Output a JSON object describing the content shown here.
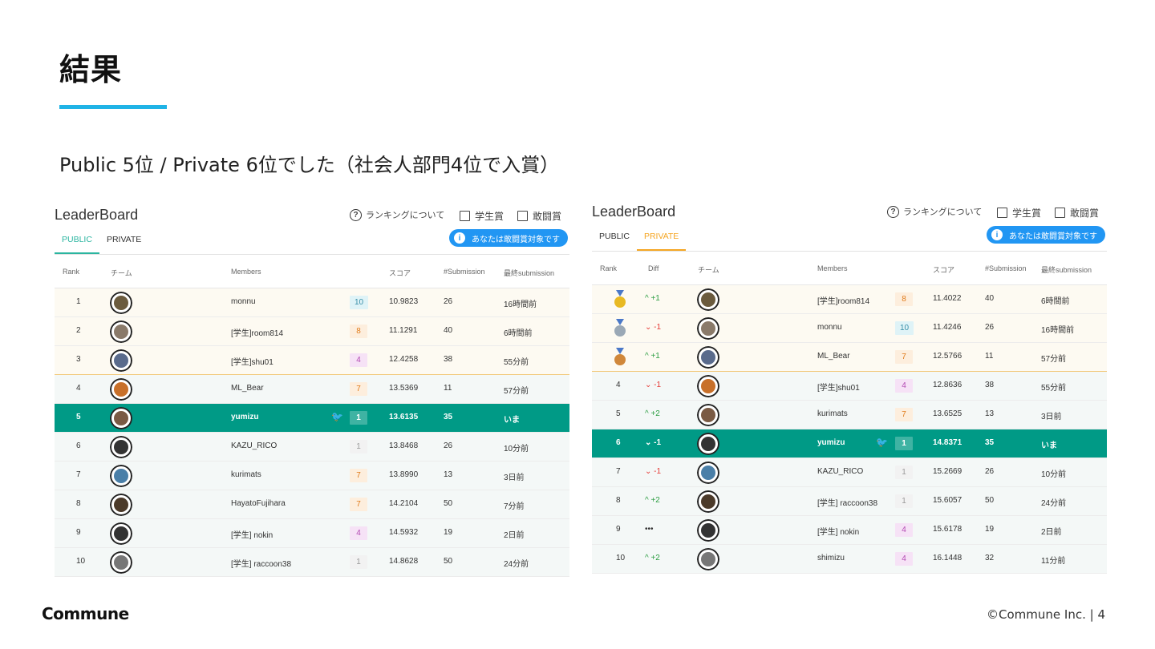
{
  "slide": {
    "title": "結果",
    "subtitle": "Public 5位 / Private 6位でした（社会人部門4位で入賞）",
    "brand": "Commune",
    "copyright": "©Commune Inc. | 4",
    "accent_color": "#1fb3e6"
  },
  "public_board": {
    "title": "LeaderBoard",
    "help_link": "ランキングについて",
    "checkbox_student": "学生賞",
    "checkbox_fighting": "敢闘賞",
    "fighting_badge": "あなたは敢闘賞対象です",
    "tab_public": "PUBLIC",
    "tab_private": "PRIVATE",
    "headers": {
      "rank": "Rank",
      "team": "チーム",
      "members": "Members",
      "score": "スコア",
      "submissions": "#Submission",
      "last": "最終submission"
    },
    "rows": [
      {
        "rank": "1",
        "members": "monnu",
        "count": "10",
        "score": "10.9823",
        "subs": "26",
        "last": "16時間前",
        "avatar": "anime-face-avatar"
      },
      {
        "rank": "2",
        "members": "[学生]room814",
        "count": "8",
        "score": "11.1291",
        "subs": "40",
        "last": "6時間前",
        "avatar": "group-avatar"
      },
      {
        "rank": "3",
        "members": "[学生]shu01",
        "count": "4",
        "score": "12.4258",
        "subs": "38",
        "last": "55分前",
        "avatar": "snowman-avatar"
      },
      {
        "rank": "4",
        "members": "ML_Bear",
        "count": "7",
        "score": "13.5369",
        "subs": "11",
        "last": "57分前",
        "avatar": "bear-avatar"
      },
      {
        "rank": "5",
        "members": "yumizu",
        "count": "1",
        "score": "13.6135",
        "subs": "35",
        "last": "いま",
        "avatar": "photo-avatar"
      },
      {
        "rank": "6",
        "members": "KAZU_RICO",
        "count": "1",
        "score": "13.8468",
        "subs": "26",
        "last": "10分前",
        "avatar": "default-face-avatar"
      },
      {
        "rank": "7",
        "members": "kurimats",
        "count": "7",
        "score": "13.8990",
        "subs": "13",
        "last": "3日前",
        "avatar": "cartoon-avatar"
      },
      {
        "rank": "8",
        "members": "HayatoFujihara",
        "count": "7",
        "score": "14.2104",
        "subs": "50",
        "last": "7分前",
        "avatar": "portrait-avatar"
      },
      {
        "rank": "9",
        "members": "[学生] nokin",
        "count": "4",
        "score": "14.5932",
        "subs": "19",
        "last": "2日前",
        "avatar": "default-face-avatar"
      },
      {
        "rank": "10",
        "members": "[学生] raccoon38",
        "count": "1",
        "score": "14.8628",
        "subs": "50",
        "last": "24分前",
        "avatar": "zebra-avatar"
      }
    ]
  },
  "private_board": {
    "title": "LeaderBoard",
    "help_link": "ランキングについて",
    "checkbox_student": "学生賞",
    "checkbox_fighting": "敢闘賞",
    "fighting_badge": "あなたは敢闘賞対象です",
    "tab_public": "PUBLIC",
    "tab_private": "PRIVATE",
    "headers": {
      "rank": "Rank",
      "diff": "Diff",
      "team": "チーム",
      "members": "Members",
      "score": "スコア",
      "submissions": "#Submission",
      "last": "最終submission"
    },
    "rows": [
      {
        "rank": "1",
        "diff": "+1",
        "members": "[学生]room814",
        "count": "8",
        "score": "11.4022",
        "subs": "40",
        "last": "6時間前",
        "medal": "gold"
      },
      {
        "rank": "2",
        "diff": "-1",
        "members": "monnu",
        "count": "10",
        "score": "11.4246",
        "subs": "26",
        "last": "16時間前",
        "medal": "silver"
      },
      {
        "rank": "3",
        "diff": "+1",
        "members": "ML_Bear",
        "count": "7",
        "score": "12.5766",
        "subs": "11",
        "last": "57分前",
        "medal": "bronze"
      },
      {
        "rank": "4",
        "diff": "-1",
        "members": "[学生]shu01",
        "count": "4",
        "score": "12.8636",
        "subs": "38",
        "last": "55分前"
      },
      {
        "rank": "5",
        "diff": "+2",
        "members": "kurimats",
        "count": "7",
        "score": "13.6525",
        "subs": "13",
        "last": "3日前"
      },
      {
        "rank": "6",
        "diff": "-1",
        "members": "yumizu",
        "count": "1",
        "score": "14.8371",
        "subs": "35",
        "last": "いま"
      },
      {
        "rank": "7",
        "diff": "-1",
        "members": "KAZU_RICO",
        "count": "1",
        "score": "15.2669",
        "subs": "26",
        "last": "10分前"
      },
      {
        "rank": "8",
        "diff": "+2",
        "members": "[学生] raccoon38",
        "count": "1",
        "score": "15.6057",
        "subs": "50",
        "last": "24分前"
      },
      {
        "rank": "9",
        "diff": "•••",
        "members": "[学生] nokin",
        "count": "4",
        "score": "15.6178",
        "subs": "19",
        "last": "2日前"
      },
      {
        "rank": "10",
        "diff": "+2",
        "members": "shimizu",
        "count": "4",
        "score": "16.1448",
        "subs": "32",
        "last": "11分前"
      }
    ]
  }
}
